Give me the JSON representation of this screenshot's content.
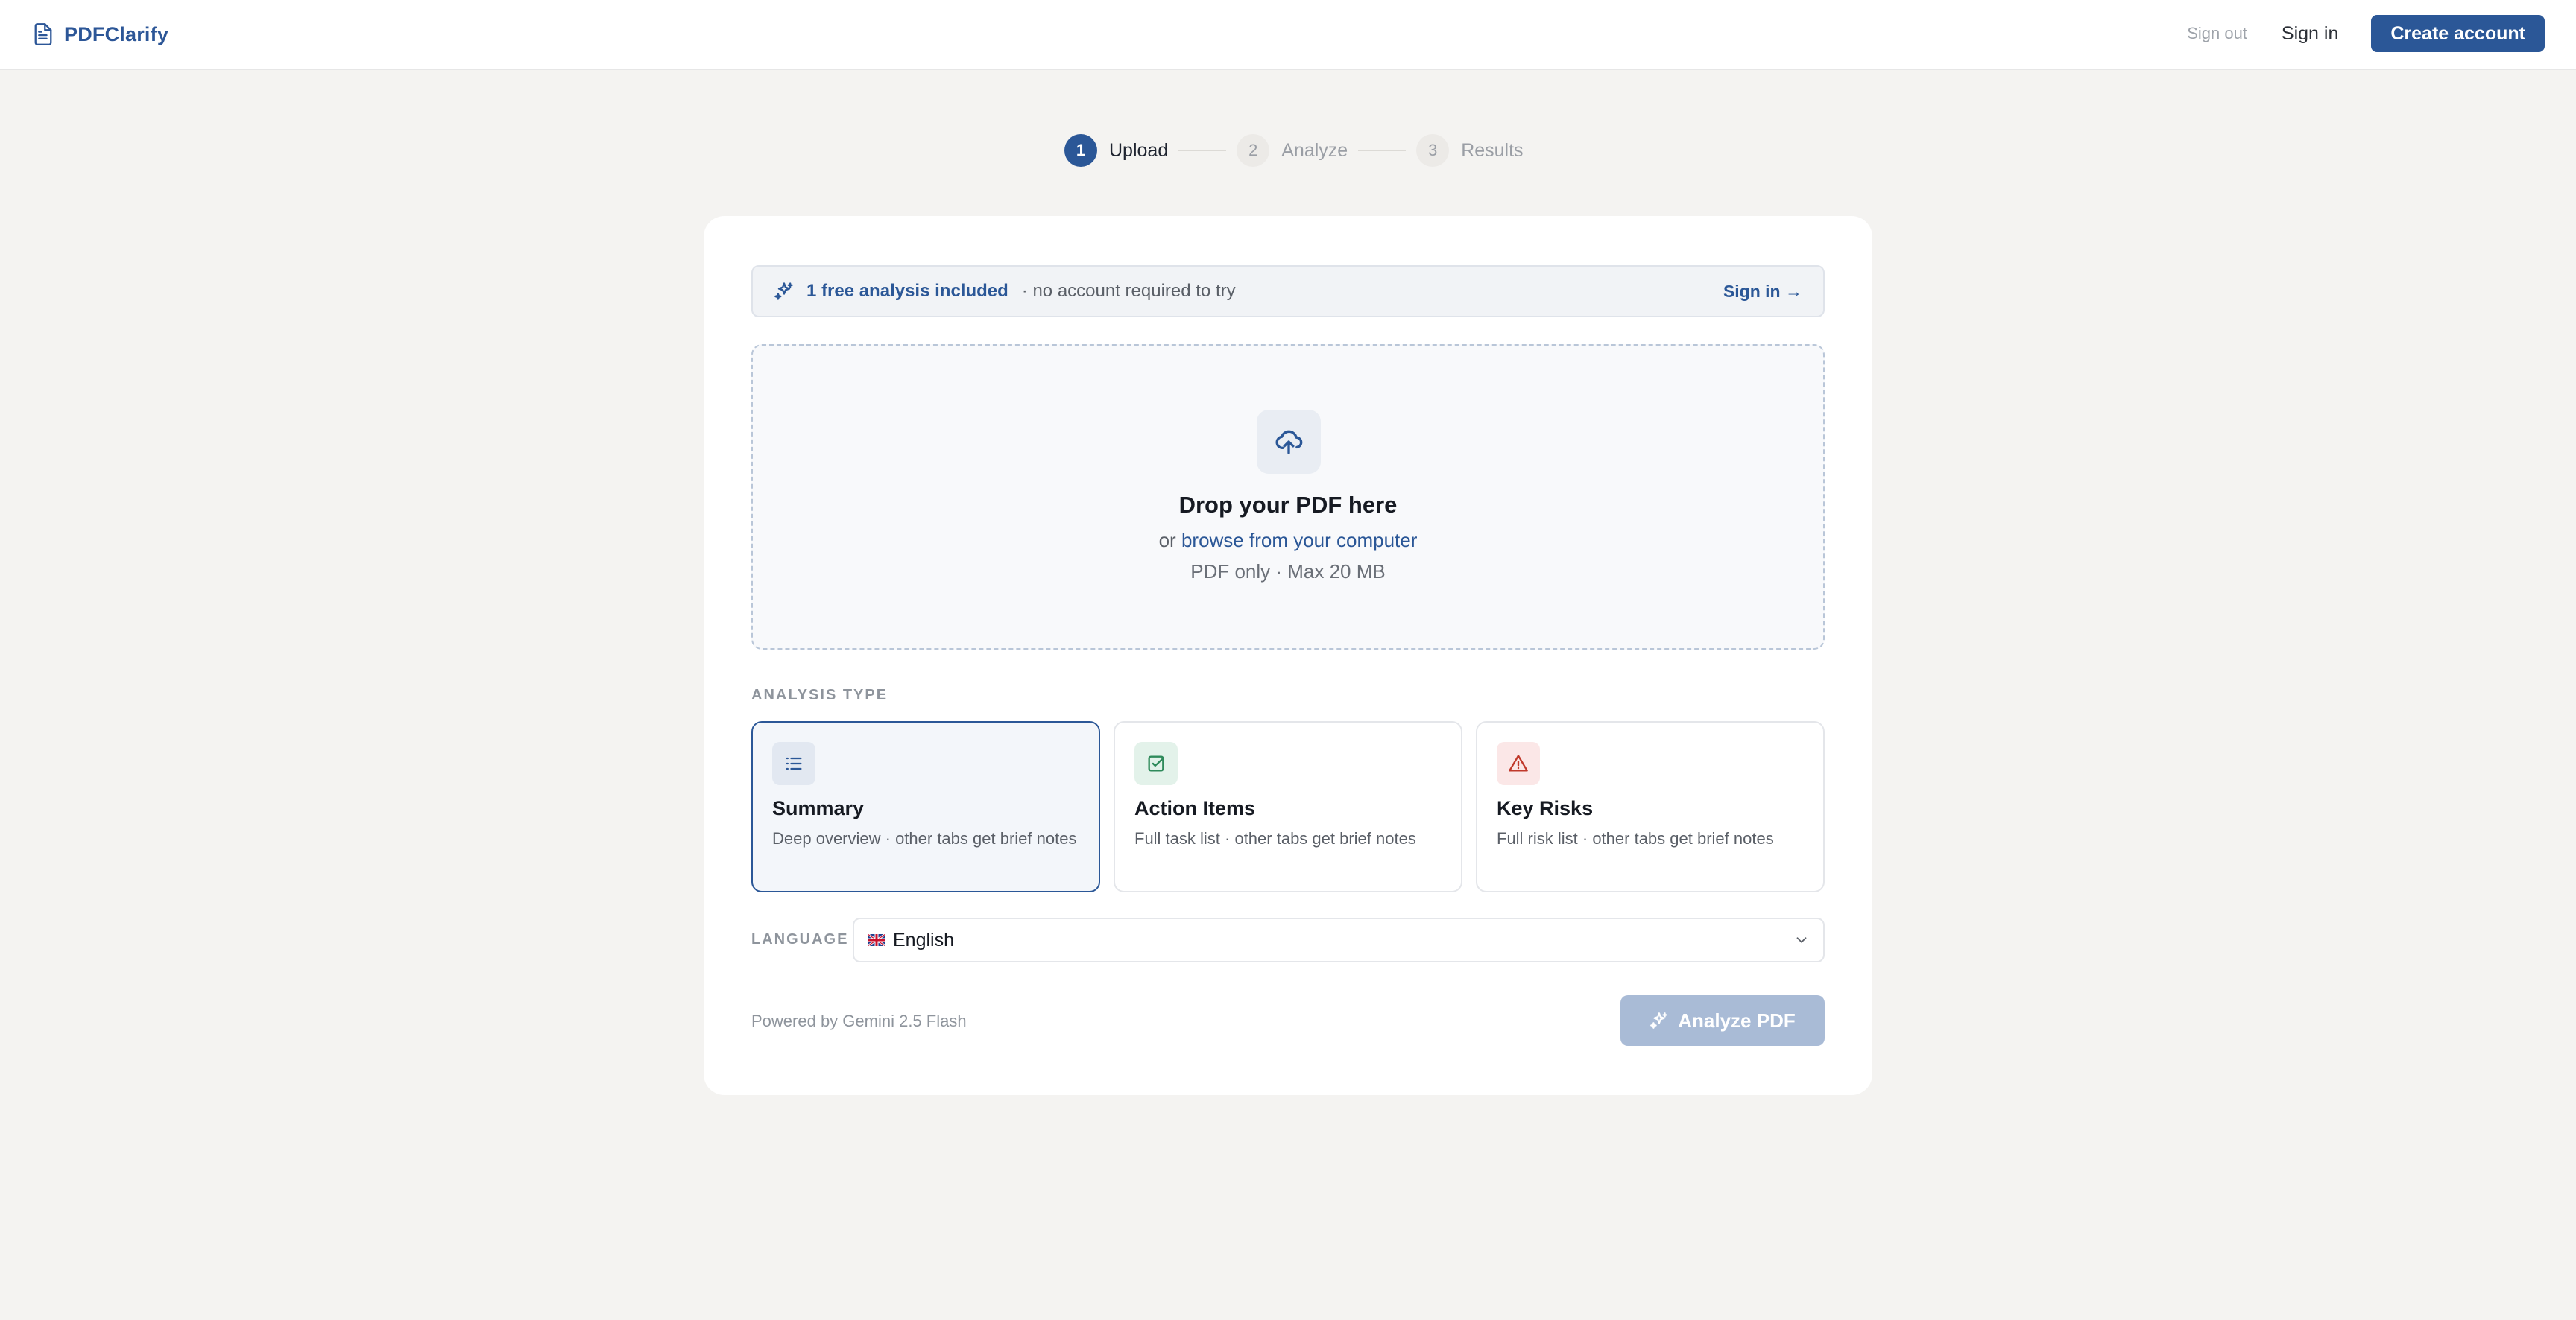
{
  "header": {
    "brand": "PDFClarify",
    "sign_out": "Sign out",
    "sign_in": "Sign in",
    "create_account": "Create account"
  },
  "stepper": {
    "steps": [
      {
        "num": "1",
        "label": "Upload"
      },
      {
        "num": "2",
        "label": "Analyze"
      },
      {
        "num": "3",
        "label": "Results"
      }
    ],
    "active_step": 1
  },
  "banner": {
    "strong": "1 free analysis included",
    "sub": "· no account required to try",
    "link": "Sign in →"
  },
  "dropzone": {
    "title": "Drop your PDF here",
    "or": "or",
    "browse": "browse from your computer",
    "hint": "PDF only · Max 20 MB"
  },
  "analysis": {
    "label": "ANALYSIS TYPE",
    "options": [
      {
        "title": "Summary",
        "desc": "Deep overview · other tabs get brief notes",
        "icon": "list-icon",
        "selected": true
      },
      {
        "title": "Action Items",
        "desc": "Full task list · other tabs get brief notes",
        "icon": "checkbox-icon",
        "selected": false
      },
      {
        "title": "Key Risks",
        "desc": "Full risk list · other tabs get brief notes",
        "icon": "warning-icon",
        "selected": false
      }
    ]
  },
  "language": {
    "label": "LANGUAGE",
    "value": "English",
    "flag": "uk-flag-icon"
  },
  "footer": {
    "powered": "Powered by Gemini 2.5 Flash",
    "analyze": "Analyze PDF"
  },
  "colors": {
    "accent": "#2b5797",
    "background": "#f4f3f1",
    "disabled_button": "#a9bbd6"
  }
}
